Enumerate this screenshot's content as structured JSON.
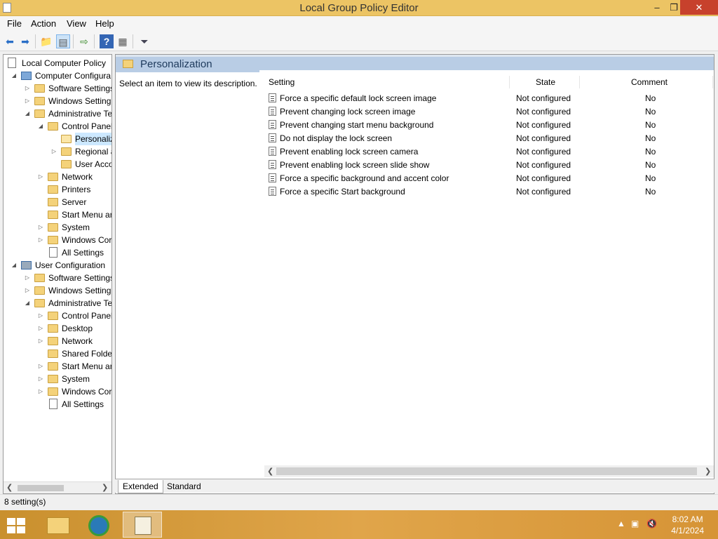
{
  "window": {
    "title": "Local Group Policy Editor",
    "minimize": "–",
    "maximize": "❐",
    "close": "✕"
  },
  "menu": {
    "items": [
      "File",
      "Action",
      "View",
      "Help"
    ]
  },
  "toolbar": {
    "icons": [
      "back-icon",
      "forward-icon",
      "up-folder-icon",
      "show-hide-tree-icon",
      "export-list-icon",
      "help-icon",
      "properties-icon",
      "filter-icon"
    ]
  },
  "tree": {
    "items": [
      {
        "label": "Local Computer Policy",
        "icon": "policy-doc-icon"
      },
      {
        "label": "Computer Configura",
        "icon": "computer-icon"
      },
      {
        "label": "Software Settings",
        "icon": "folder-icon"
      },
      {
        "label": "Windows Setting",
        "icon": "folder-icon"
      },
      {
        "label": "Administrative Te",
        "icon": "folder-icon"
      },
      {
        "label": "Control Panel",
        "icon": "folder-icon"
      },
      {
        "label": "Personaliz",
        "icon": "folder-open-icon"
      },
      {
        "label": "Regional a",
        "icon": "folder-icon"
      },
      {
        "label": "User Acco",
        "icon": "folder-icon"
      },
      {
        "label": "Network",
        "icon": "folder-icon"
      },
      {
        "label": "Printers",
        "icon": "folder-icon"
      },
      {
        "label": "Server",
        "icon": "folder-icon"
      },
      {
        "label": "Start Menu ar",
        "icon": "folder-icon"
      },
      {
        "label": "System",
        "icon": "folder-icon"
      },
      {
        "label": "Windows Cor",
        "icon": "folder-icon"
      },
      {
        "label": "All Settings",
        "icon": "all-settings-icon"
      },
      {
        "label": "User Configuration",
        "icon": "user-icon"
      },
      {
        "label": "Software Settings",
        "icon": "folder-icon"
      },
      {
        "label": "Windows Setting",
        "icon": "folder-icon"
      },
      {
        "label": "Administrative Te",
        "icon": "folder-icon"
      },
      {
        "label": "Control Panel",
        "icon": "folder-icon"
      },
      {
        "label": "Desktop",
        "icon": "folder-icon"
      },
      {
        "label": "Network",
        "icon": "folder-icon"
      },
      {
        "label": "Shared Folder",
        "icon": "folder-icon"
      },
      {
        "label": "Start Menu ar",
        "icon": "folder-icon"
      },
      {
        "label": "System",
        "icon": "folder-icon"
      },
      {
        "label": "Windows Cor",
        "icon": "folder-icon"
      },
      {
        "label": "All Settings",
        "icon": "all-settings-icon"
      }
    ]
  },
  "header": {
    "title": "Personalization"
  },
  "description": "Select an item to view its description.",
  "list": {
    "columns": [
      "Setting",
      "State",
      "Comment"
    ],
    "rows": [
      {
        "setting": "Force a specific default lock screen image",
        "state": "Not configured",
        "comment": "No"
      },
      {
        "setting": "Prevent changing lock screen image",
        "state": "Not configured",
        "comment": "No"
      },
      {
        "setting": "Prevent changing start menu background",
        "state": "Not configured",
        "comment": "No"
      },
      {
        "setting": "Do not display the lock screen",
        "state": "Not configured",
        "comment": "No"
      },
      {
        "setting": "Prevent enabling lock screen camera",
        "state": "Not configured",
        "comment": "No"
      },
      {
        "setting": "Prevent enabling lock screen slide show",
        "state": "Not configured",
        "comment": "No"
      },
      {
        "setting": "Force a specific background and accent color",
        "state": "Not configured",
        "comment": "No"
      },
      {
        "setting": "Force a specific Start background",
        "state": "Not configured",
        "comment": "No"
      }
    ]
  },
  "tabs": [
    "Extended",
    "Standard"
  ],
  "status": "8 setting(s)",
  "taskbar": {
    "clock_time": "8:02 AM",
    "clock_date": "4/1/2024"
  },
  "colors": {
    "titlebar": "#ecc464",
    "close": "#c7412c",
    "header": "#b9cde5",
    "taskbar": "#d69436"
  }
}
